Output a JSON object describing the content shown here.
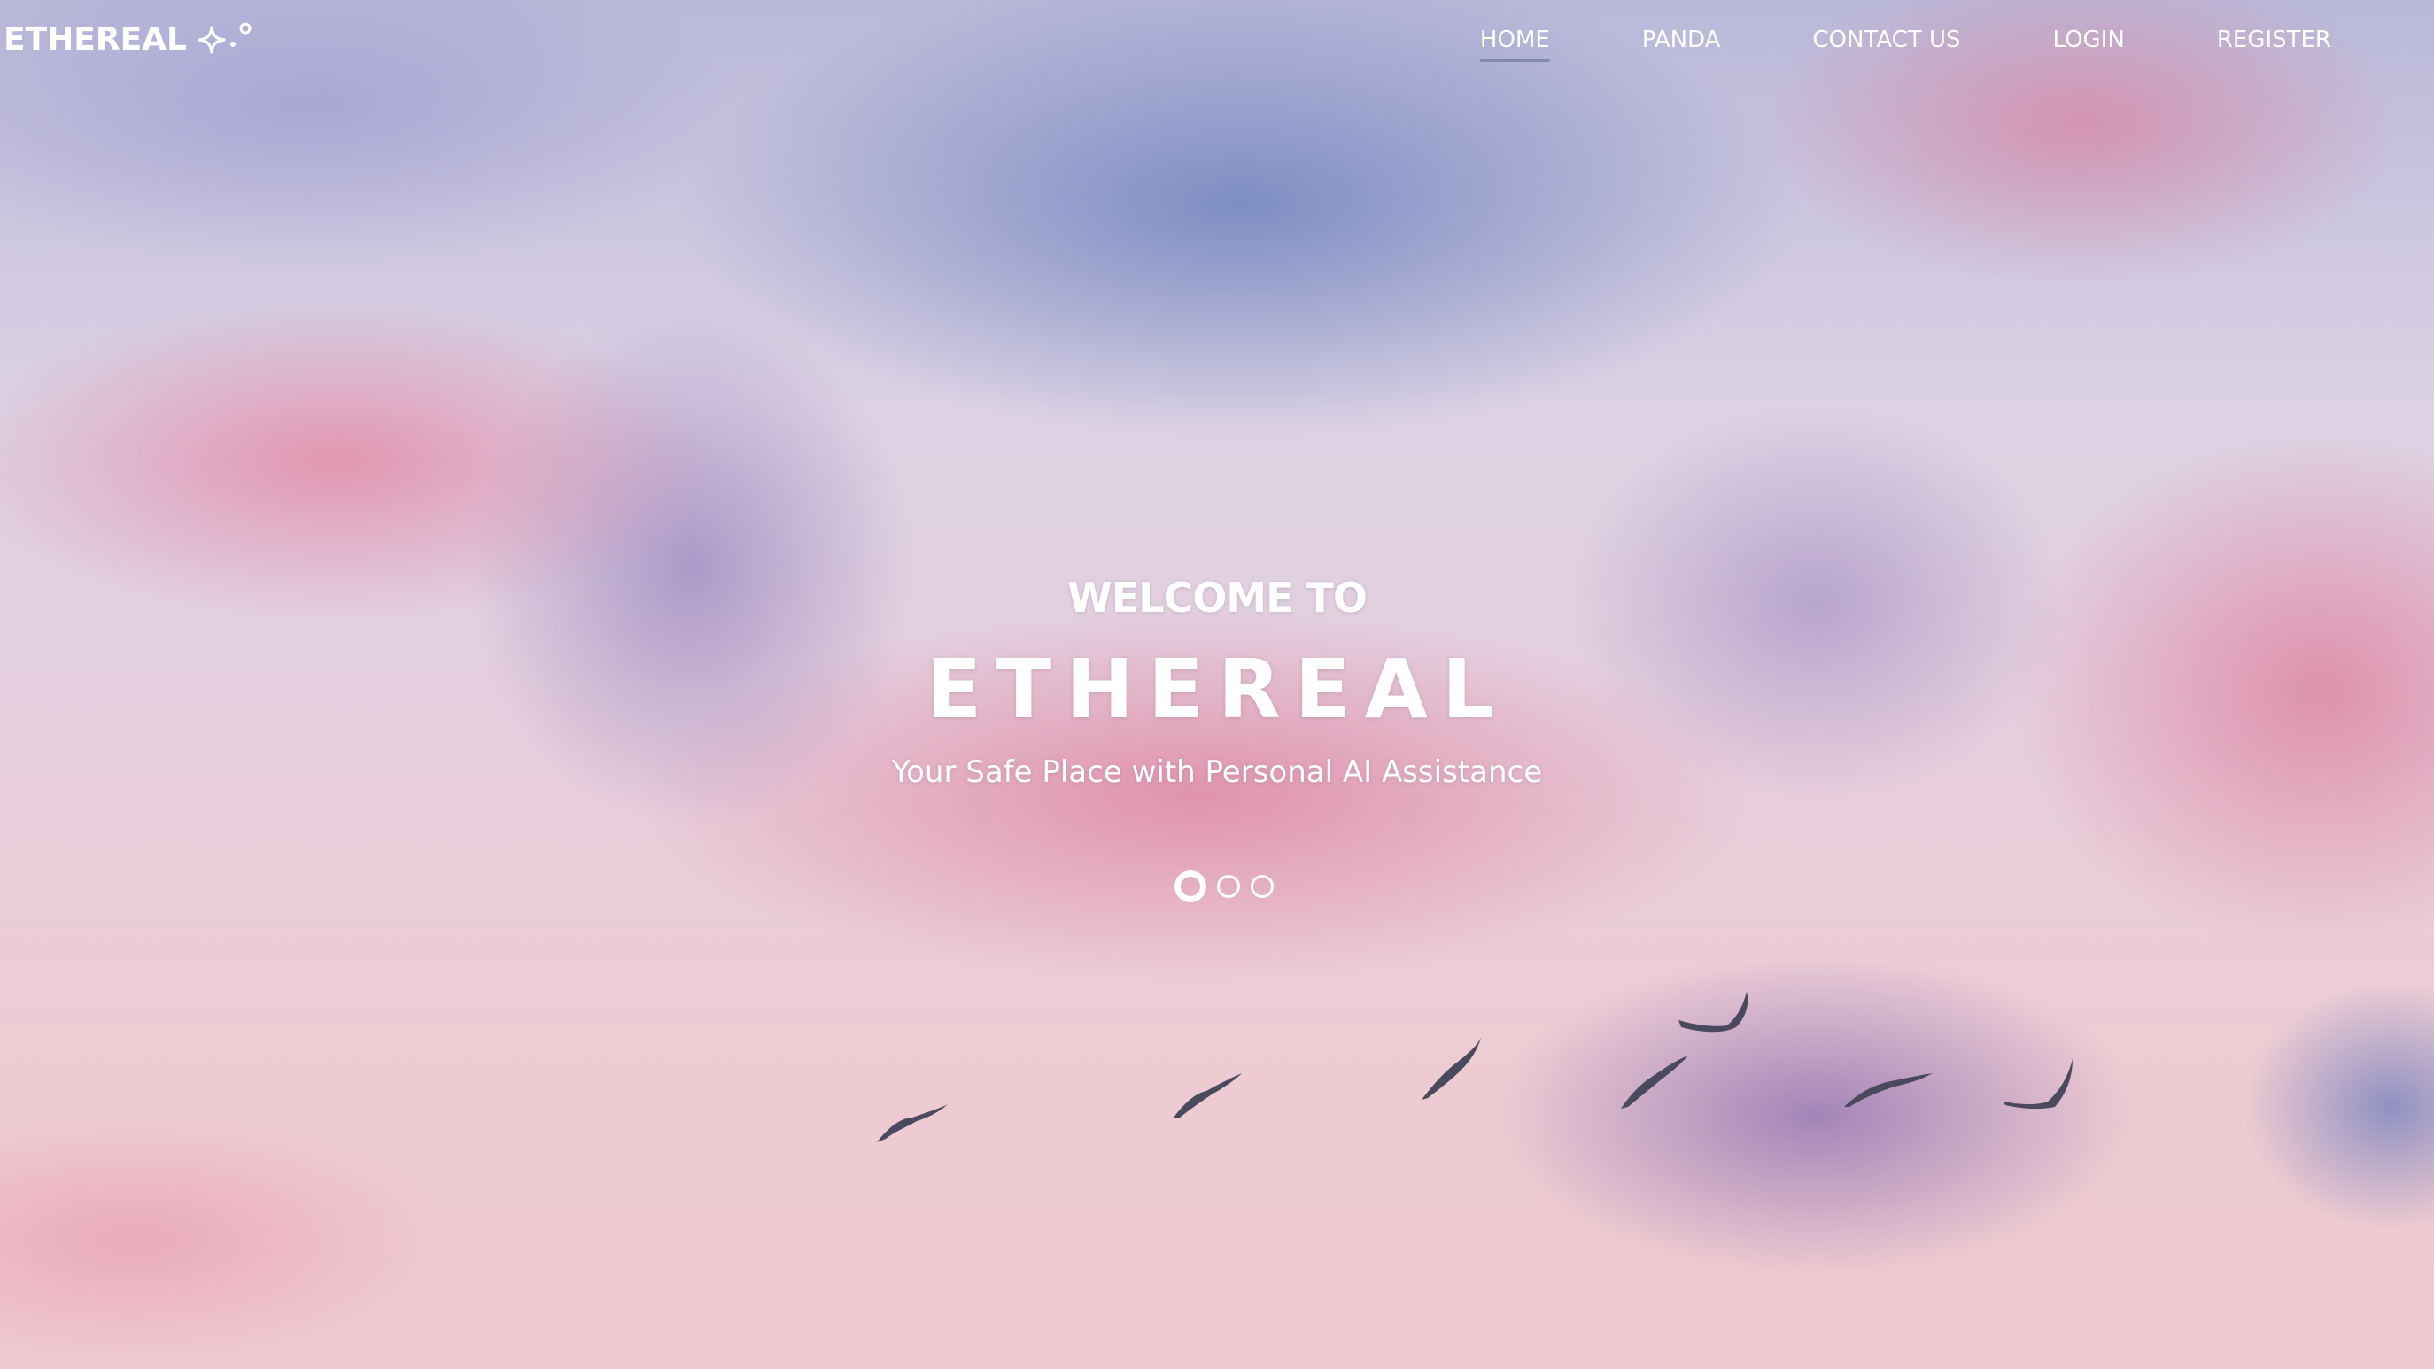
{
  "header": {
    "logo_text": "ETHEREAL",
    "logo_icon": "sparkle-icon"
  },
  "nav": {
    "items": [
      {
        "label": "HOME",
        "active": true
      },
      {
        "label": "PANDA",
        "active": false
      },
      {
        "label": "CONTACT US",
        "active": false
      },
      {
        "label": "LOGIN",
        "active": false
      },
      {
        "label": "REGISTER",
        "active": false
      }
    ]
  },
  "hero": {
    "welcome": "WELCOME TO",
    "title": "ETHEREAL",
    "tagline": "Your Safe Place with Personal AI Assistance",
    "background": "pink-purple-sky-with-birds"
  },
  "carousel": {
    "slide_count": 3,
    "active_index": 0
  },
  "colors": {
    "text": "#ffffff",
    "sky_top": "#b9b8d9",
    "sky_bottom": "#efc9cf",
    "bird": "#4a4a5e"
  }
}
